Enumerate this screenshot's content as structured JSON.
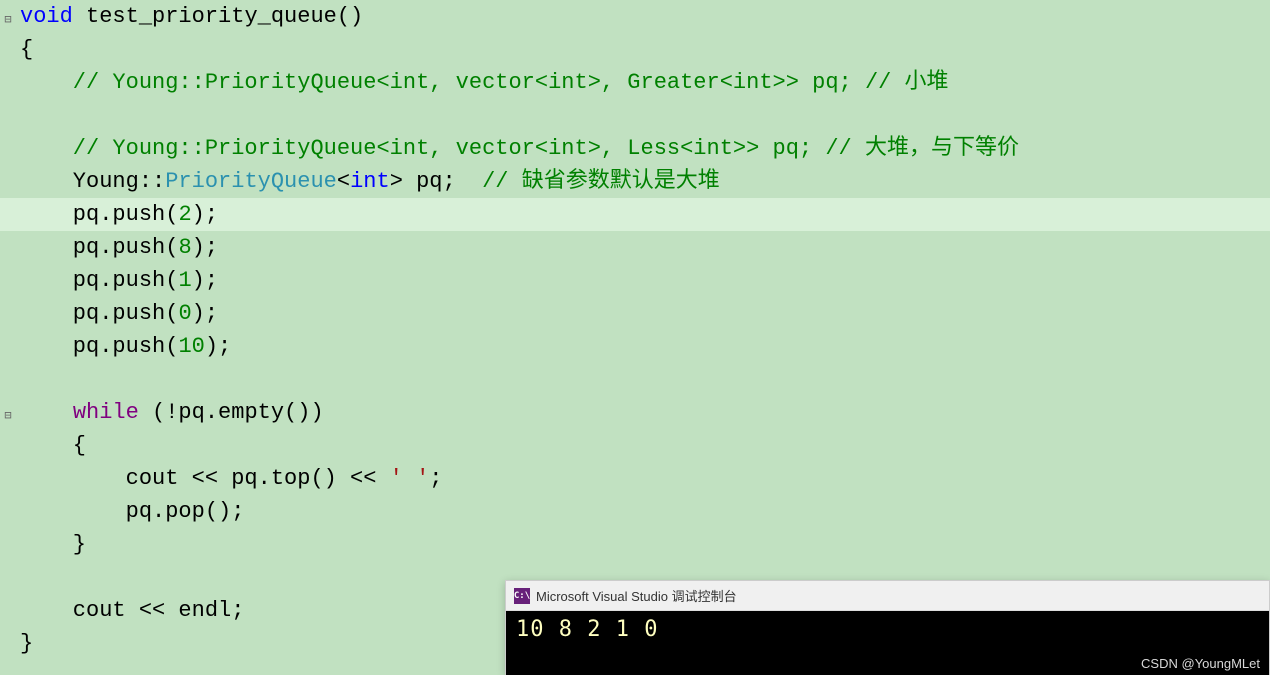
{
  "code": {
    "l1_kw": "void",
    "l1_fn": " test_priority_queue()",
    "l2": "{",
    "l3": "    // Young::PriorityQueue<int, vector<int>, Greater<int>> pq; // 小堆",
    "l5": "    // Young::PriorityQueue<int, vector<int>, Less<int>> pq; // 大堆，与下等价",
    "l6_a": "    Young::",
    "l6_b": "PriorityQueue",
    "l6_c": "<",
    "l6_d": "int",
    "l6_e": "> pq;  ",
    "l6_f": "// 缺省参数默认是大堆",
    "l7_a": "    pq.push(",
    "l7_b": "2",
    "l7_c": ");",
    "l8_a": "    pq.push(",
    "l8_b": "8",
    "l8_c": ");",
    "l9_a": "    pq.push(",
    "l9_b": "1",
    "l9_c": ");",
    "l10_a": "    pq.push(",
    "l10_b": "0",
    "l10_c": ");",
    "l11_a": "    pq.push(",
    "l11_b": "10",
    "l11_c": ");",
    "l13_a": "    ",
    "l13_b": "while",
    "l13_c": " (!pq.empty())",
    "l14": "    {",
    "l15_a": "        cout << pq.top() << ",
    "l15_b": "' '",
    "l15_c": ";",
    "l16": "        pq.pop();",
    "l17": "    }",
    "l19": "    cout << endl;",
    "l20": "}"
  },
  "gutter": {
    "collapse1": "⊟",
    "collapse2": "⊟"
  },
  "console": {
    "icon_text": "C:\\",
    "title": "Microsoft Visual Studio 调试控制台",
    "output": "10  8  2  1  0"
  },
  "watermark": "CSDN @YoungMLet"
}
